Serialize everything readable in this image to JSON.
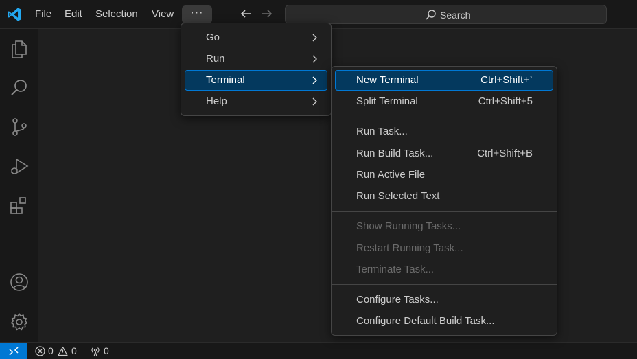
{
  "titlebar": {
    "menus": [
      "File",
      "Edit",
      "Selection",
      "View"
    ],
    "more_label": "···",
    "search_label": "Search"
  },
  "submenu_parent": {
    "items": [
      {
        "label": "Go"
      },
      {
        "label": "Run"
      },
      {
        "label": "Terminal"
      },
      {
        "label": "Help"
      }
    ]
  },
  "terminal_menu": {
    "new_terminal": {
      "label": "New Terminal",
      "shortcut": "Ctrl+Shift+`"
    },
    "split_terminal": {
      "label": "Split Terminal",
      "shortcut": "Ctrl+Shift+5"
    },
    "run_task": {
      "label": "Run Task..."
    },
    "run_build_task": {
      "label": "Run Build Task...",
      "shortcut": "Ctrl+Shift+B"
    },
    "run_active_file": {
      "label": "Run Active File"
    },
    "run_selected_text": {
      "label": "Run Selected Text"
    },
    "show_running_tasks": {
      "label": "Show Running Tasks..."
    },
    "restart_running_task": {
      "label": "Restart Running Task..."
    },
    "terminate_task": {
      "label": "Terminate Task..."
    },
    "configure_tasks": {
      "label": "Configure Tasks..."
    },
    "configure_default_build_task": {
      "label": "Configure Default Build Task..."
    }
  },
  "statusbar": {
    "errors": "0",
    "warnings": "0",
    "ports": "0"
  },
  "colors": {
    "accent": "#0078d4",
    "selected_bg": "#04395e",
    "logo": "#23a9f2"
  }
}
